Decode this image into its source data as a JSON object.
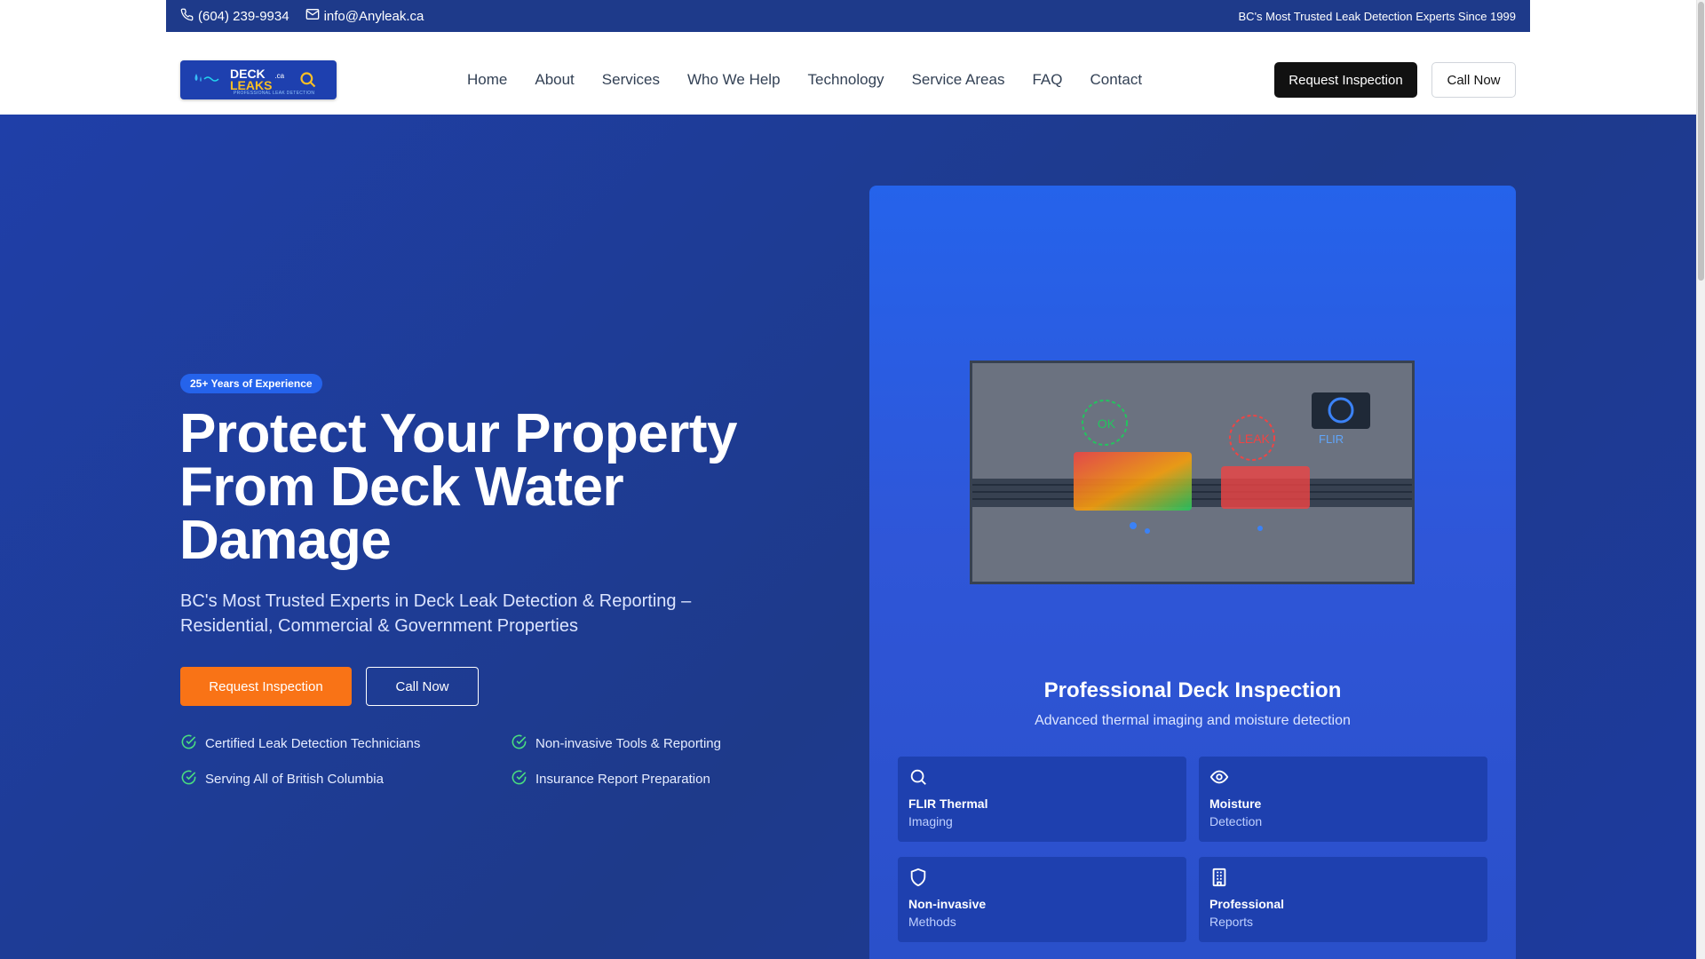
{
  "topbar": {
    "phone": "(604) 239-9934",
    "email": "info@Anyleak.ca",
    "tagline": "BC's Most Trusted Leak Detection Experts Since 1999"
  },
  "logo": {
    "line1": "DECK",
    "line2": "LEAKS",
    "suffix": ".ca",
    "tagline": "PROFESSIONAL LEAK DETECTION"
  },
  "nav": {
    "items": [
      "Home",
      "About",
      "Services",
      "Who We Help",
      "Technology",
      "Service Areas",
      "FAQ",
      "Contact"
    ],
    "request_label": "Request Inspection",
    "call_label": "Call Now"
  },
  "hero": {
    "badge": "25+ Years of Experience",
    "title": "Protect Your Property From Deck Water Damage",
    "subtitle": "BC's Most Trusted Experts in Deck Leak Detection & Reporting – Residential, Commercial & Government Properties",
    "request_label": "Request Inspection",
    "call_label": "Call Now",
    "features": [
      "Certified Leak Detection Technicians",
      "Non-invasive Tools & Reporting",
      "Serving All of British Columbia",
      "Insurance Report Preparation"
    ]
  },
  "card": {
    "screen": {
      "ok_label": "OK",
      "leak_label": "LEAK",
      "camera_label": "FLIR"
    },
    "title": "Professional Deck Inspection",
    "subtitle": "Advanced thermal imaging and moisture detection",
    "tiles": [
      {
        "icon": "search-icon",
        "line1": "FLIR Thermal",
        "line2": "Imaging"
      },
      {
        "icon": "eye-icon",
        "line1": "Moisture",
        "line2": "Detection"
      },
      {
        "icon": "shield-icon",
        "line1": "Non-invasive",
        "line2": "Methods"
      },
      {
        "icon": "building-icon",
        "line1": "Professional",
        "line2": "Reports"
      }
    ]
  },
  "colors": {
    "topbar_bg": "#1e3a8a",
    "hero_bg": "#1e3a8a",
    "accent_orange": "#f97316",
    "badge_blue": "#2563eb",
    "check_green": "#4ade80"
  }
}
